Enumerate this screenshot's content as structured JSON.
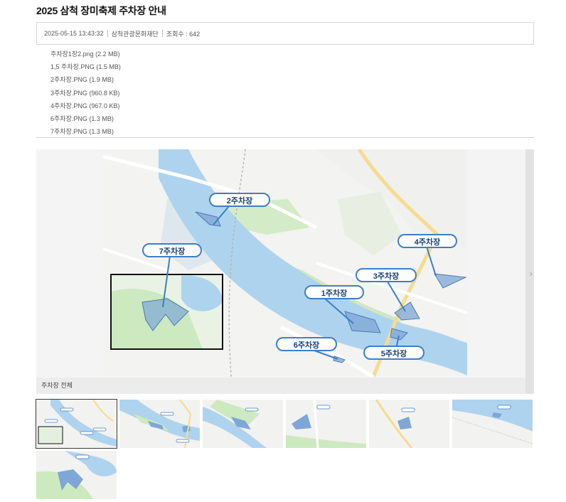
{
  "post": {
    "title": "2025 삼척 장미축제 주차장 안내",
    "date": "2025-05-15 13:43:32",
    "author": "삼척관광문화재단",
    "views": "조회수 : 642"
  },
  "attachments": [
    "주차장1장2.png (2.2 MB)",
    "1,5 주차장.PNG (1.5 MB)",
    "2주차장.PNG (1.9 MB)",
    "3주차장.PNG (960.8 KB)",
    "4주차장.PNG (967.0 KB)",
    "6주차장.PNG (1.3 MB)",
    "7주차장.PNG (1.3 MB)"
  ],
  "viewer": {
    "caption": "주차장 전체",
    "next_icon": "chevron-right-icon"
  },
  "map": {
    "labels": {
      "p1": "1주차장",
      "p2": "2주차장",
      "p3": "3주차장",
      "p4": "4주차장",
      "p5": "5주차장",
      "p6": "6주차장",
      "p7": "7주차장"
    },
    "colors": {
      "river": "#aed3ee",
      "park": "#cde9c0",
      "lot": "#7ea6d6",
      "label_border": "#3f7ec4"
    }
  },
  "thumbnails": {
    "count": 7,
    "selected_index": 0
  }
}
